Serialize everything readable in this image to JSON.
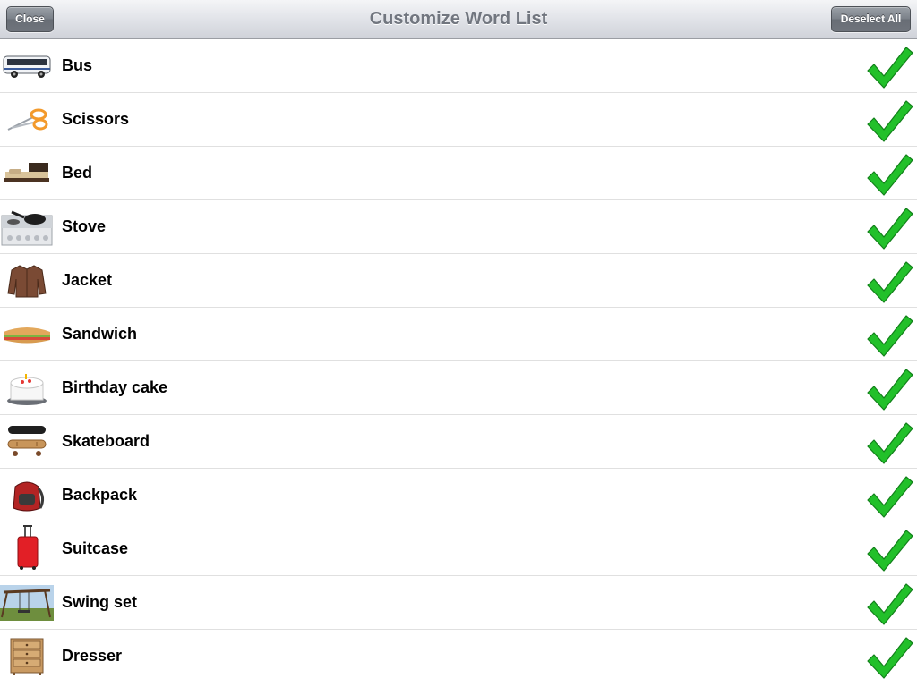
{
  "navbar": {
    "title": "Customize Word List",
    "close_label": "Close",
    "deselect_label": "Deselect All"
  },
  "words": [
    {
      "label": "Bus",
      "icon": "bus-icon",
      "selected": true
    },
    {
      "label": "Scissors",
      "icon": "scissors-icon",
      "selected": true
    },
    {
      "label": "Bed",
      "icon": "bed-icon",
      "selected": true
    },
    {
      "label": "Stove",
      "icon": "stove-icon",
      "selected": true
    },
    {
      "label": "Jacket",
      "icon": "jacket-icon",
      "selected": true
    },
    {
      "label": "Sandwich",
      "icon": "sandwich-icon",
      "selected": true
    },
    {
      "label": "Birthday cake",
      "icon": "cake-icon",
      "selected": true
    },
    {
      "label": "Skateboard",
      "icon": "skateboard-icon",
      "selected": true
    },
    {
      "label": "Backpack",
      "icon": "backpack-icon",
      "selected": true
    },
    {
      "label": "Suitcase",
      "icon": "suitcase-icon",
      "selected": true
    },
    {
      "label": "Swing set",
      "icon": "swing-set-icon",
      "selected": true
    },
    {
      "label": "Dresser",
      "icon": "dresser-icon",
      "selected": true
    }
  ],
  "colors": {
    "checkmark": "#22c02a",
    "title": "#71767f"
  }
}
